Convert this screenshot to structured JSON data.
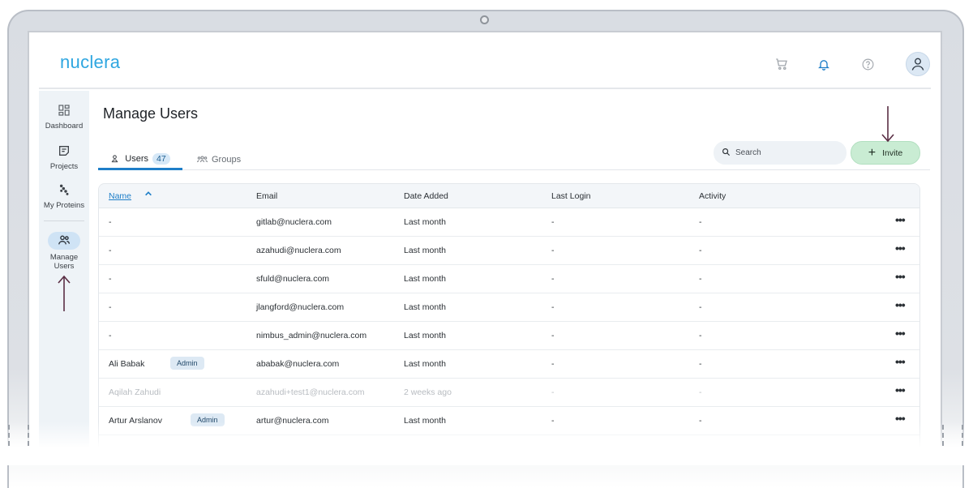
{
  "brand": {
    "logo_text": "nuclera",
    "accent": "#2ea6e0",
    "primary": "#1e7ec8",
    "invite_bg": "#c9ecd3"
  },
  "header": {
    "icons": [
      "cart-icon",
      "bell-icon",
      "help-icon",
      "avatar-icon"
    ]
  },
  "sidebar": {
    "items": [
      {
        "label": "Dashboard",
        "icon": "dashboard-icon"
      },
      {
        "label": "Projects",
        "icon": "projects-icon"
      },
      {
        "label": "My Proteins",
        "icon": "proteins-icon"
      },
      {
        "label": "Manage Users",
        "icon": "users-icon",
        "active": true
      }
    ]
  },
  "main": {
    "title": "Manage Users",
    "tabs": [
      {
        "label": "Users",
        "count": "47",
        "active": true
      },
      {
        "label": "Groups"
      }
    ],
    "search": {
      "placeholder": "Search"
    },
    "invite_label": "Invite"
  },
  "table": {
    "columns": [
      "Name",
      "Email",
      "Date Added",
      "Last Login",
      "Activity"
    ],
    "rows": [
      {
        "name": "-",
        "email": "gitlab@nuclera.com",
        "date_added": "Last month",
        "last_login": "-",
        "activity": "-"
      },
      {
        "name": "-",
        "email": "azahudi@nuclera.com",
        "date_added": "Last month",
        "last_login": "-",
        "activity": "-"
      },
      {
        "name": "-",
        "email": "sfuld@nuclera.com",
        "date_added": "Last month",
        "last_login": "-",
        "activity": "-"
      },
      {
        "name": "-",
        "email": "jlangford@nuclera.com",
        "date_added": "Last month",
        "last_login": "-",
        "activity": "-"
      },
      {
        "name": "-",
        "email": "nimbus_admin@nuclera.com",
        "date_added": "Last month",
        "last_login": "-",
        "activity": "-"
      },
      {
        "name": "Ali Babak",
        "badge": "Admin",
        "email": "ababak@nuclera.com",
        "date_added": "Last month",
        "last_login": "-",
        "activity": "-"
      },
      {
        "name": "Aqilah Zahudi",
        "email": "azahudi+test1@nuclera.com",
        "date_added": "2 weeks ago",
        "last_login": "-",
        "activity": "-",
        "muted": true
      },
      {
        "name": "Artur Arslanov",
        "badge": "Admin",
        "email": "artur@nuclera.com",
        "date_added": "Last month",
        "last_login": "-",
        "activity": "-"
      }
    ],
    "row_menu": "•••"
  }
}
